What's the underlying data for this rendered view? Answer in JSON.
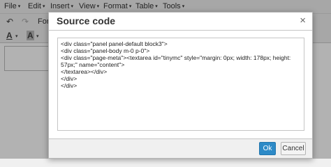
{
  "menubar": {
    "items": [
      {
        "label": "File"
      },
      {
        "label": "Edit"
      },
      {
        "label": "Insert"
      },
      {
        "label": "View"
      },
      {
        "label": "Format"
      },
      {
        "label": "Table"
      },
      {
        "label": "Tools"
      }
    ],
    "caret": "▾"
  },
  "toolbar": {
    "undo_icon": "↶",
    "redo_icon": "↷",
    "format_label": "Form",
    "font_color_icon": "A",
    "bg_color_icon": "A",
    "fullscreen_icon": "⤢"
  },
  "dialog": {
    "title": "Source code",
    "close_icon": "×",
    "code": "<div class=\"panel panel-default block3\">\n<div class=\"panel-body m-0 p-0\">\n<div class=\"page-meta\"><textarea id=\"tinymc\" style=\"margin: 0px; width: 178px; height: 57px;\" name=\"content\">\n</textarea></div>\n</div>\n</div>",
    "ok_label": "Ok",
    "cancel_label": "Cancel"
  },
  "colors": {
    "primary_button": "#2d8ac7",
    "overlay": "rgba(0,0,0,0.30)"
  }
}
